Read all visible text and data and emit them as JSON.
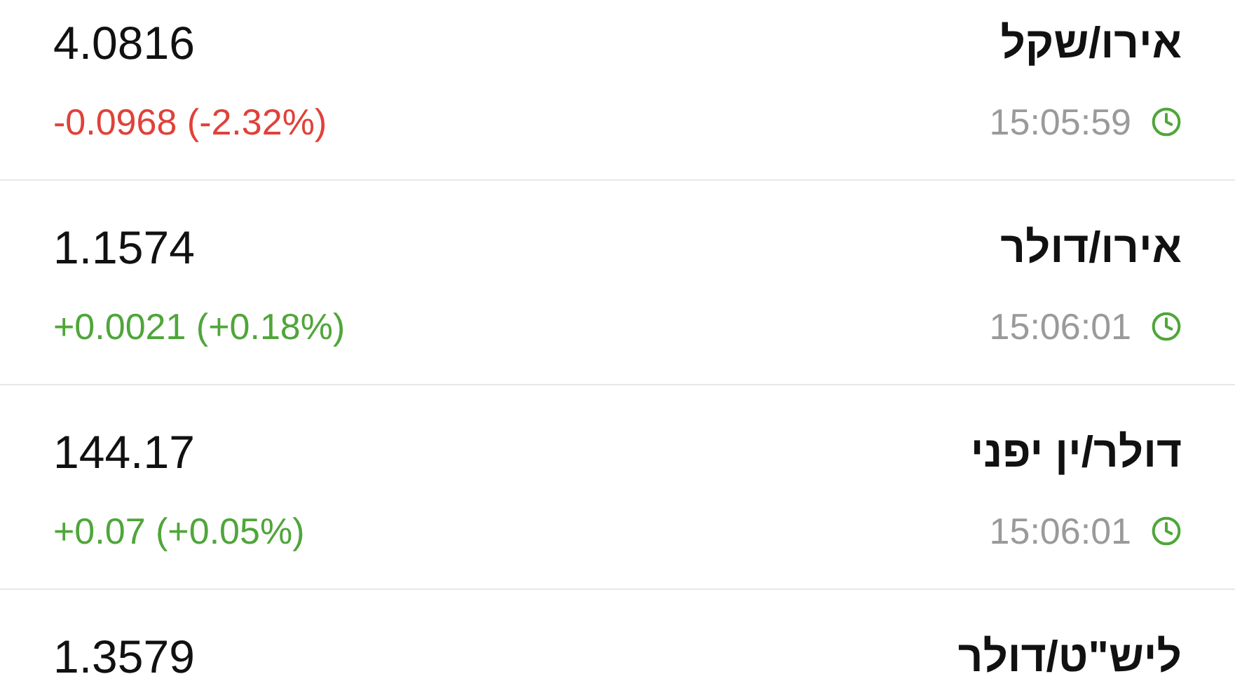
{
  "rates": [
    {
      "name": "אירו/שקל",
      "price": "4.0816",
      "change": "-0.0968 (-2.32%)",
      "color": "#e0413a",
      "time": "15:05:59"
    },
    {
      "name": "אירו/דולר",
      "price": "1.1574",
      "change": "+0.0021 (+0.18%)",
      "color": "#4fa63a",
      "time": "15:06:01"
    },
    {
      "name": "דולר/ין יפני",
      "price": "144.17",
      "change": "+0.07 (+0.05%)",
      "color": "#4fa63a",
      "time": "15:06:01"
    },
    {
      "name": "ליש\"ט/דולר",
      "price": "1.3579"
    }
  ]
}
